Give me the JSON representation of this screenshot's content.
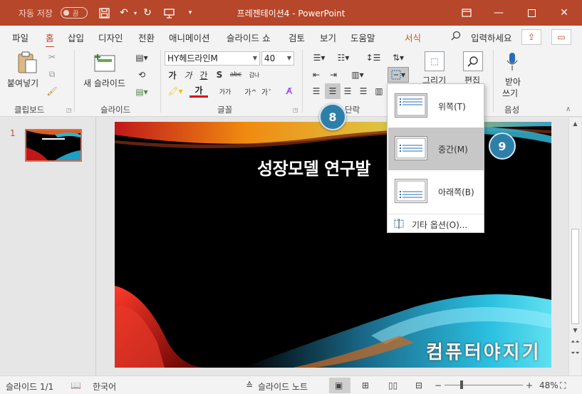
{
  "titlebar": {
    "autosave_label": "자동 저장",
    "autosave_state": "끔",
    "document_title": "프레젠테이션4 - PowerPoint"
  },
  "tabs": [
    {
      "label": "파일"
    },
    {
      "label": "홈"
    },
    {
      "label": "삽입"
    },
    {
      "label": "디자인"
    },
    {
      "label": "전환"
    },
    {
      "label": "애니메이션"
    },
    {
      "label": "슬라이드 쇼"
    },
    {
      "label": "검토"
    },
    {
      "label": "보기"
    },
    {
      "label": "도움말"
    },
    {
      "label": "서식"
    }
  ],
  "search": {
    "label": "입력하세요"
  },
  "ribbon": {
    "clipboard": {
      "paste_label": "붙여넣기",
      "group_label": "클립보드"
    },
    "slides": {
      "new_slide_label": "새 슬라이드",
      "group_label": "슬라이드"
    },
    "font": {
      "font_name": "HY헤드라인M",
      "font_size": "40",
      "group_label": "글꼴",
      "bold_glyph": "가",
      "italic_glyph": "가",
      "underline_glyph": "간",
      "shadow_glyph": "S",
      "strike_glyph": "abc",
      "spacing_glyph": "갑나",
      "font_color_glyph": "가",
      "case_glyph": "가가",
      "grow_glyph": "가^",
      "shrink_glyph": "가ˇ"
    },
    "paragraph": {
      "group_label": "단락"
    },
    "drawing": {
      "label": "그리기"
    },
    "editing": {
      "label": "편집"
    },
    "voice": {
      "label_line1": "받아",
      "label_line2": "쓰기",
      "group_label": "음성"
    }
  },
  "thumbnail": {
    "number": "1"
  },
  "slide": {
    "title": "성장모델 연구발"
  },
  "align_menu": {
    "items": [
      {
        "label": "위쪽(T)"
      },
      {
        "label": "중간(M)"
      },
      {
        "label": "아래쪽(B)"
      }
    ],
    "more_label": "기타 옵션(O)..."
  },
  "callouts": {
    "first": "8",
    "second": "9"
  },
  "statusbar": {
    "slide_count": "슬라이드 1/1",
    "language": "한국어",
    "notes_label": "슬라이드 노트",
    "zoom": "48%"
  },
  "watermark": "컴퓨터야지기"
}
